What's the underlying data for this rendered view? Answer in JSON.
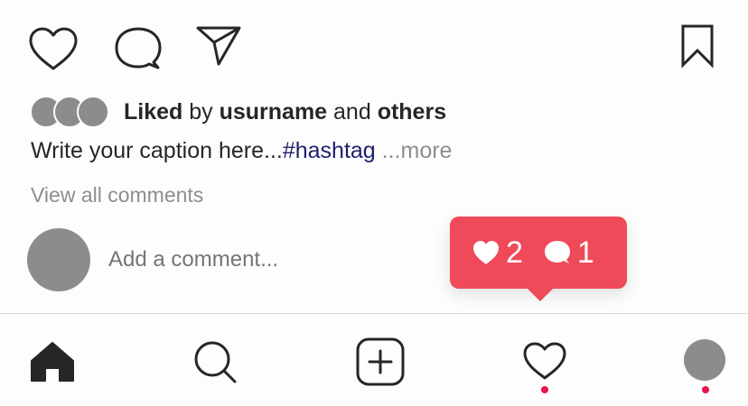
{
  "actions": {
    "like_icon": "heart-outline-icon",
    "comment_icon": "speech-bubble-icon",
    "share_icon": "paper-plane-icon",
    "save_icon": "bookmark-icon"
  },
  "likes": {
    "prefix": "Liked",
    "by": " by ",
    "user": "usurname",
    "and": " and ",
    "others": "others"
  },
  "caption": {
    "text": "Write your caption here...",
    "hashtag": "#hashtag",
    "more": " ...more"
  },
  "comments": {
    "view_all": "View all comments",
    "add_placeholder": "Add a comment..."
  },
  "notification": {
    "likes_count": "2",
    "comments_count": "1",
    "color": "#ef4a5a"
  },
  "tabbar": {
    "home_icon": "home-icon",
    "search_icon": "search-icon",
    "add_icon": "add-post-icon",
    "activity_icon": "heart-activity-icon",
    "profile_icon": "profile-avatar",
    "dot_color": "#e8144a"
  }
}
